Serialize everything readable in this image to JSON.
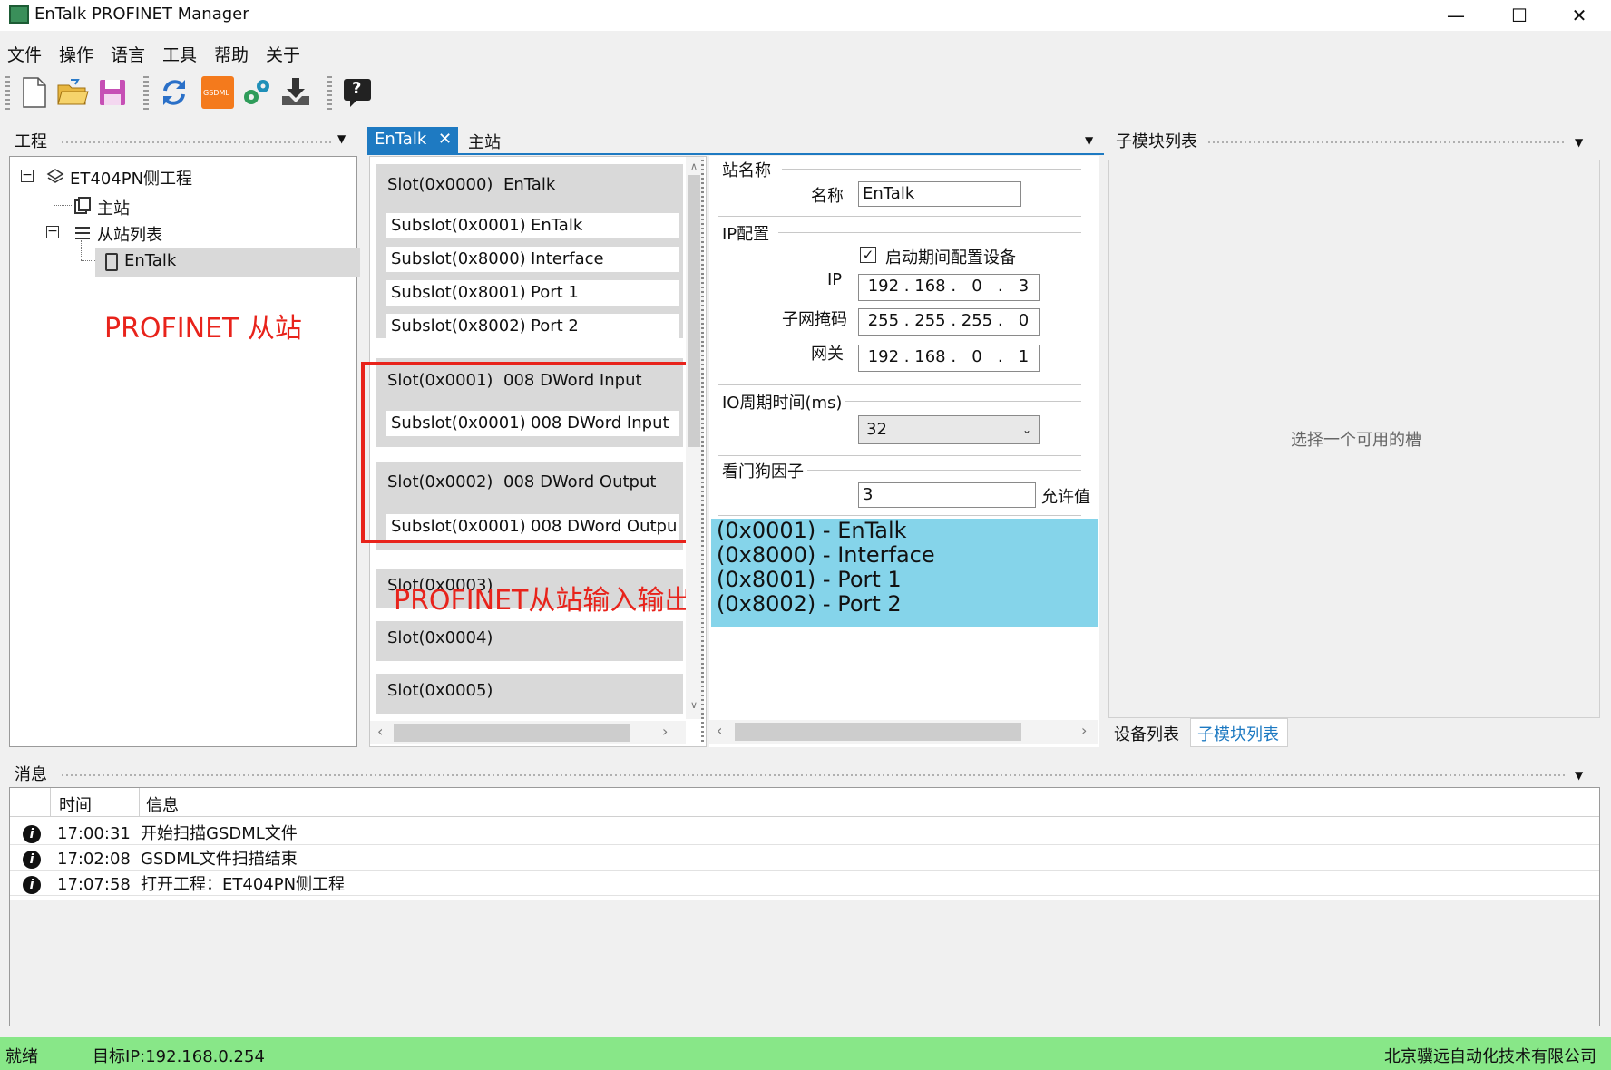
{
  "window": {
    "title": "EnTalk PROFINET Manager",
    "minimize_glyph": "—",
    "maximize_glyph": "☐",
    "close_glyph": "✕"
  },
  "menu": [
    "文件",
    "操作",
    "语言",
    "工具",
    "帮助",
    "关于"
  ],
  "toolbar": {
    "icons": [
      "new-file-icon",
      "open-folder-icon",
      "save-icon",
      "refresh-icon",
      "gsdml-icon",
      "settings-gears-icon",
      "download-icon",
      "help-icon"
    ],
    "gsdml_text": "GSDML",
    "help_glyph": "?"
  },
  "project_pane": {
    "title": "工程",
    "tree": {
      "root": "ET404PN侧工程",
      "master": "主站",
      "slave_list": "从站列表",
      "slave": "EnTalk"
    },
    "annotation": "PROFINET 从站"
  },
  "tabs": {
    "active": "EnTalk",
    "close_glyph": "✕",
    "other": "主站"
  },
  "slots": [
    {
      "slot": "Slot(0x0000)",
      "name": "EnTalk",
      "subslots": [
        {
          "id": "Subslot(0x0001)",
          "name": "EnTalk"
        },
        {
          "id": "Subslot(0x8000)",
          "name": "Interface"
        },
        {
          "id": "Subslot(0x8001)",
          "name": "Port 1"
        },
        {
          "id": "Subslot(0x8002)",
          "name": "Port 2"
        }
      ]
    },
    {
      "slot": "Slot(0x0001)",
      "name": "008 DWord Input",
      "subslots": [
        {
          "id": "Subslot(0x0001)",
          "name": "008 DWord Input"
        }
      ]
    },
    {
      "slot": "Slot(0x0002)",
      "name": "008 DWord Output",
      "subslots": [
        {
          "id": "Subslot(0x0001)",
          "name": "008 DWord Outpu"
        }
      ]
    },
    {
      "slot": "Slot(0x0003)",
      "name": "",
      "subslots": []
    },
    {
      "slot": "Slot(0x0004)",
      "name": "",
      "subslots": []
    },
    {
      "slot": "Slot(0x0005)",
      "name": "",
      "subslots": []
    }
  ],
  "slot_annotation": "PROFINET从站输入输出",
  "config": {
    "station_name_group": "站名称",
    "name_label": "名称",
    "name_value": "EnTalk",
    "ip_group": "IP配置",
    "startup_config_label": "启动期间配置设备",
    "startup_config_checked": true,
    "ip_label": "IP",
    "ip_value": " 192 . 168 .   0   .   3",
    "mask_label": "子网掩码",
    "mask_value": " 255 . 255 . 255 .   0",
    "gateway_label": "网关",
    "gateway_value": " 192 . 168 .   0   .   1",
    "io_cycle_label": "IO周期时间(ms)",
    "io_cycle_value": "32",
    "watchdog_label": "看门狗因子",
    "watchdog_value": "3",
    "allow_label": "允许值",
    "modules": [
      "(0x0001)  -  EnTalk",
      "(0x8000)  -  Interface",
      "(0x8001)  -  Port 1",
      "(0x8002)  -  Port 2"
    ]
  },
  "submodule_pane": {
    "title": "子模块列表",
    "placeholder": "选择一个可用的槽",
    "bottom_tabs": [
      "设备列表",
      "子模块列表"
    ]
  },
  "messages": {
    "title": "消息",
    "col_time": "时间",
    "col_info": "信息",
    "rows": [
      {
        "time": "17:00:31",
        "info": "开始扫描GSDML文件"
      },
      {
        "time": "17:02:08",
        "info": "GSDML文件扫描结束"
      },
      {
        "time": "17:07:58",
        "info": "打开工程：ET404PN侧工程"
      }
    ],
    "info_glyph": "i"
  },
  "statusbar": {
    "state": "就绪",
    "target_ip": "目标IP:192.168.0.254",
    "company": "北京骥远自动化技术有限公司"
  },
  "colors": {
    "accent_blue": "#1e7ac2",
    "highlight_cyan": "#85d4ea",
    "status_green": "#88e788",
    "annotation_red": "#e8231b"
  }
}
